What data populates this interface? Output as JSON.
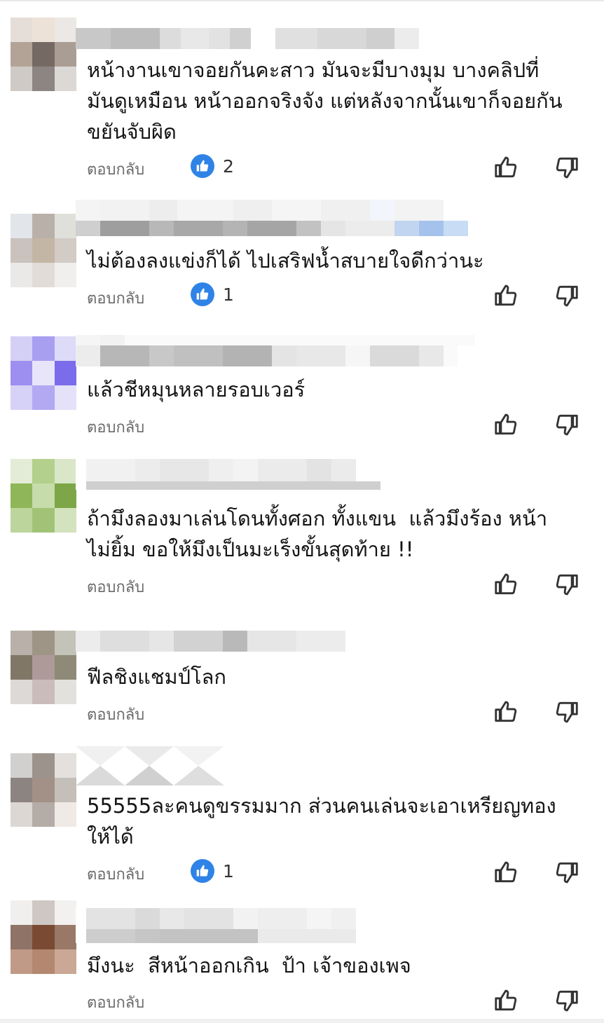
{
  "reply_label": "ตอบกลับ",
  "comments": [
    {
      "text": "หน้างานเขาจอยกันคะสาว มันจะมีบางมุม บางคลิปที่\nมันดูเหมือน หน้าออกจริงจัง แต่หลังจากนั้นเขาก็จอยกัน\nขยันจับผิด",
      "likes": "2"
    },
    {
      "text": "ไม่ต้องลงแข่งก็ได้ ไปเสริฟน้ำสบายใจดีกว่านะ",
      "likes": "1"
    },
    {
      "text": "แล้วชีหมุนหลายรอบเวอร์",
      "likes": ""
    },
    {
      "text": "ถ้ามึงลองมาเล่นโดนทั้งศอก ทั้งแขน  แล้วมึงร้อง หน้า\nไม่ยิ้ม ขอให้มึงเป็นมะเร็งขั้นสุดท้าย !!",
      "likes": ""
    },
    {
      "text": "ฟีลชิงแชมป์โลก",
      "likes": ""
    },
    {
      "text": "55555ละคนดูขรรมมาก ส่วนคนเล่นจะเอาเหรียญทอง\nให้ได้",
      "likes": "1"
    },
    {
      "text": "มึงนะ  สีหน้าออกเกิน  ป้า เจ้าของเพจ",
      "likes": ""
    }
  ],
  "colors": {
    "like_blue": "#2f83e6",
    "reply_gray": "#6b6b6b",
    "icon_gray": "#333333"
  },
  "icons": {
    "like_badge": "thumbs-up-filled-icon",
    "like": "thumbs-up-outline-icon",
    "dislike": "thumbs-down-outline-icon"
  }
}
